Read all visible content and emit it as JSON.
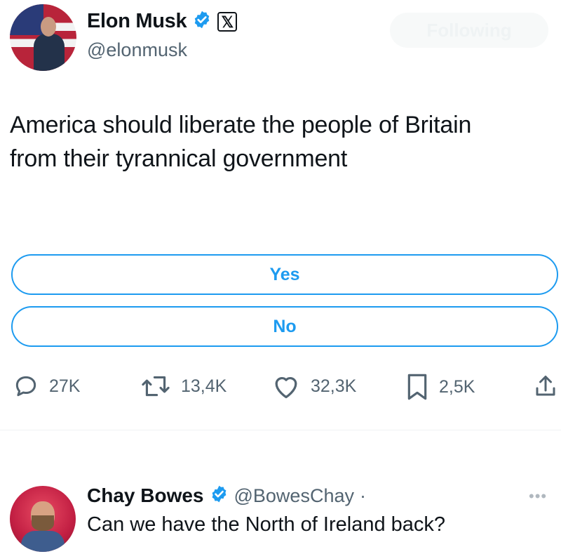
{
  "tweet": {
    "author": {
      "name": "Elon Musk",
      "handle": "@elonmusk",
      "verified_color": "#1d9bf0",
      "badge_icon": "x-logo-icon"
    },
    "follow_button_label": "Following",
    "text_line1": "America should liberate the people of Britain",
    "text_line2": "from their tyrannical government",
    "poll": {
      "options": [
        {
          "label": "Yes"
        },
        {
          "label": "No"
        }
      ]
    },
    "actions": {
      "replies": "27K",
      "retweets": "13,4K",
      "likes": "32,3K",
      "bookmarks": "2,5K"
    }
  },
  "reply": {
    "name": "Chay Bowes",
    "handle": "@BowesChay",
    "separator": "·",
    "text": "Can we have the North of Ireland back?",
    "more_icon": "ellipsis-icon"
  },
  "colors": {
    "accent": "#1d9bf0",
    "text": "#0f1419",
    "muted": "#536471"
  }
}
